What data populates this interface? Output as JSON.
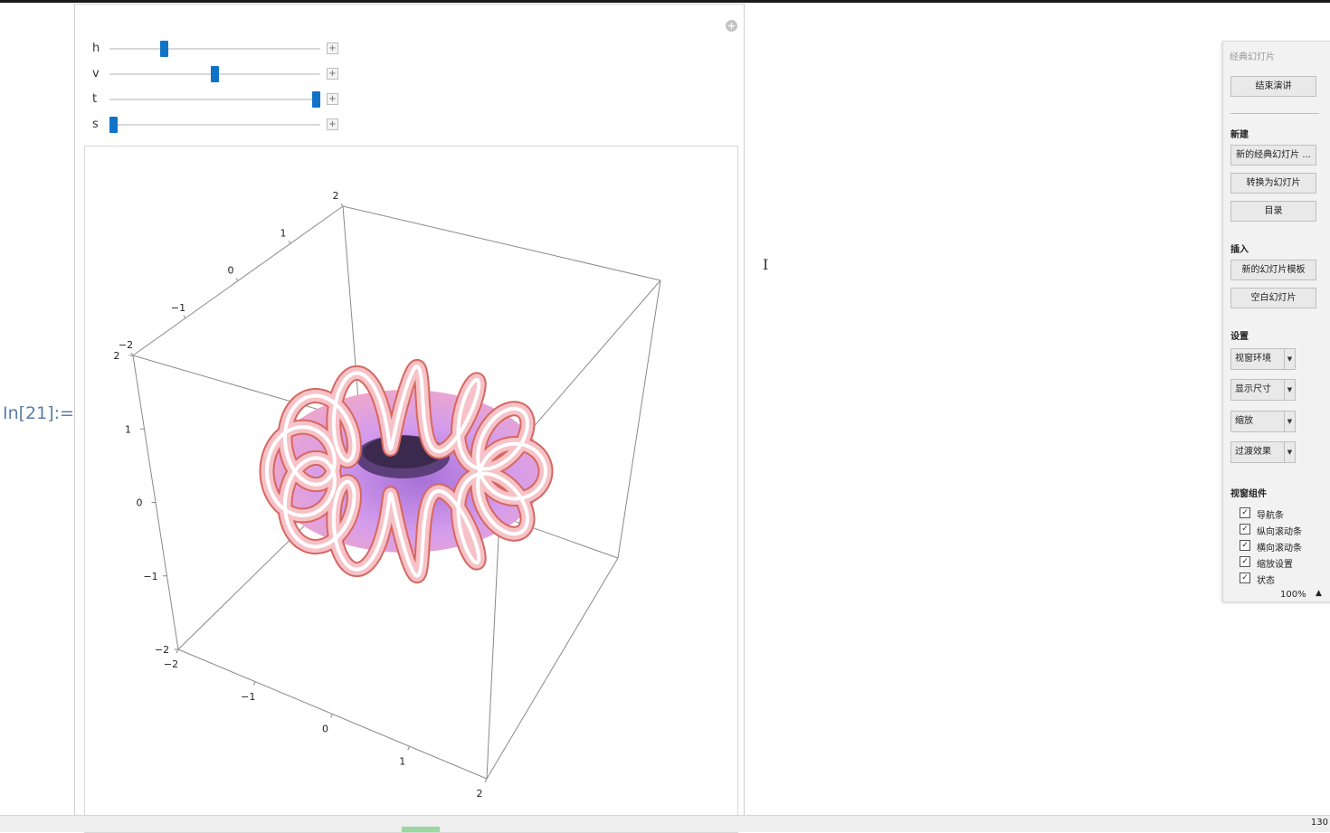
{
  "cell": {
    "input_label": "In[21]:="
  },
  "sliders": [
    {
      "name": "h",
      "level": 0.25
    },
    {
      "name": "v",
      "level": 0.5
    },
    {
      "name": "t",
      "level": 1.0
    },
    {
      "name": "s",
      "level": 0.0
    }
  ],
  "plot": {
    "type": "3d-surface",
    "axis_range": [
      -2,
      2
    ],
    "y_ticks": [
      "−2",
      "−1",
      "0",
      "1",
      "2"
    ],
    "z_ticks": [
      "−2",
      "−1",
      "0",
      "1",
      "2"
    ],
    "x_ticks": [
      "−2",
      "−1",
      "0",
      "1",
      "2"
    ],
    "colors": {
      "torus": "#c99cf0",
      "tube": "#f6c2c8"
    }
  },
  "panel": {
    "title": "经典幻灯片",
    "end_button": "结束演讲",
    "new_section": "新建",
    "new_buttons": [
      "新的经典幻灯片 ...",
      "转换为幻灯片",
      "目录"
    ],
    "insert_section": "插入",
    "insert_buttons": [
      "新的幻灯片模板",
      "空白幻灯片"
    ],
    "settings_section": "设置",
    "dropdowns": [
      "视窗环境",
      "显示尺寸",
      "缩放",
      "过渡效果"
    ],
    "window_section": "视窗组件",
    "checkboxes": [
      {
        "label": "导航条",
        "checked": true
      },
      {
        "label": "纵向滚动条",
        "checked": true
      },
      {
        "label": "横向滚动条",
        "checked": true
      },
      {
        "label": "缩放设置",
        "checked": true
      },
      {
        "label": "状态",
        "checked": true
      }
    ],
    "zoom": "100%"
  },
  "statusbar": {
    "zoom": "130"
  }
}
